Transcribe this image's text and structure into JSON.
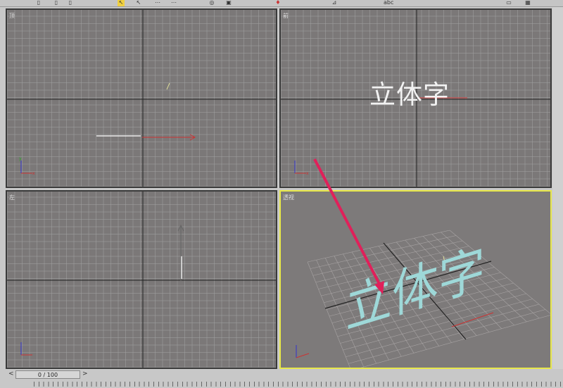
{
  "viewports": {
    "top": {
      "label": "顶"
    },
    "front": {
      "label": "前",
      "text_object": "立体字"
    },
    "left": {
      "label": "左"
    },
    "perspective": {
      "label": "透视",
      "text_object": "立体字"
    }
  },
  "toolbar": {
    "icons": [
      "undo-icon",
      "link-icon",
      "unlink-icon",
      "bind-icon",
      "select-icon",
      "select-by-name-icon",
      "rect-select-icon",
      "window-crossing-icon",
      "move-icon",
      "rotate-icon",
      "scale-icon",
      "mirror-icon",
      "align-icon",
      "spell-icon"
    ]
  },
  "timeline": {
    "frame_display": "0 / 100",
    "prev": "<",
    "next": ">"
  },
  "colors": {
    "viewport_bg": "#7b7878",
    "active_border": "#e8e84a",
    "annotation_arrow": "#e0205a"
  }
}
